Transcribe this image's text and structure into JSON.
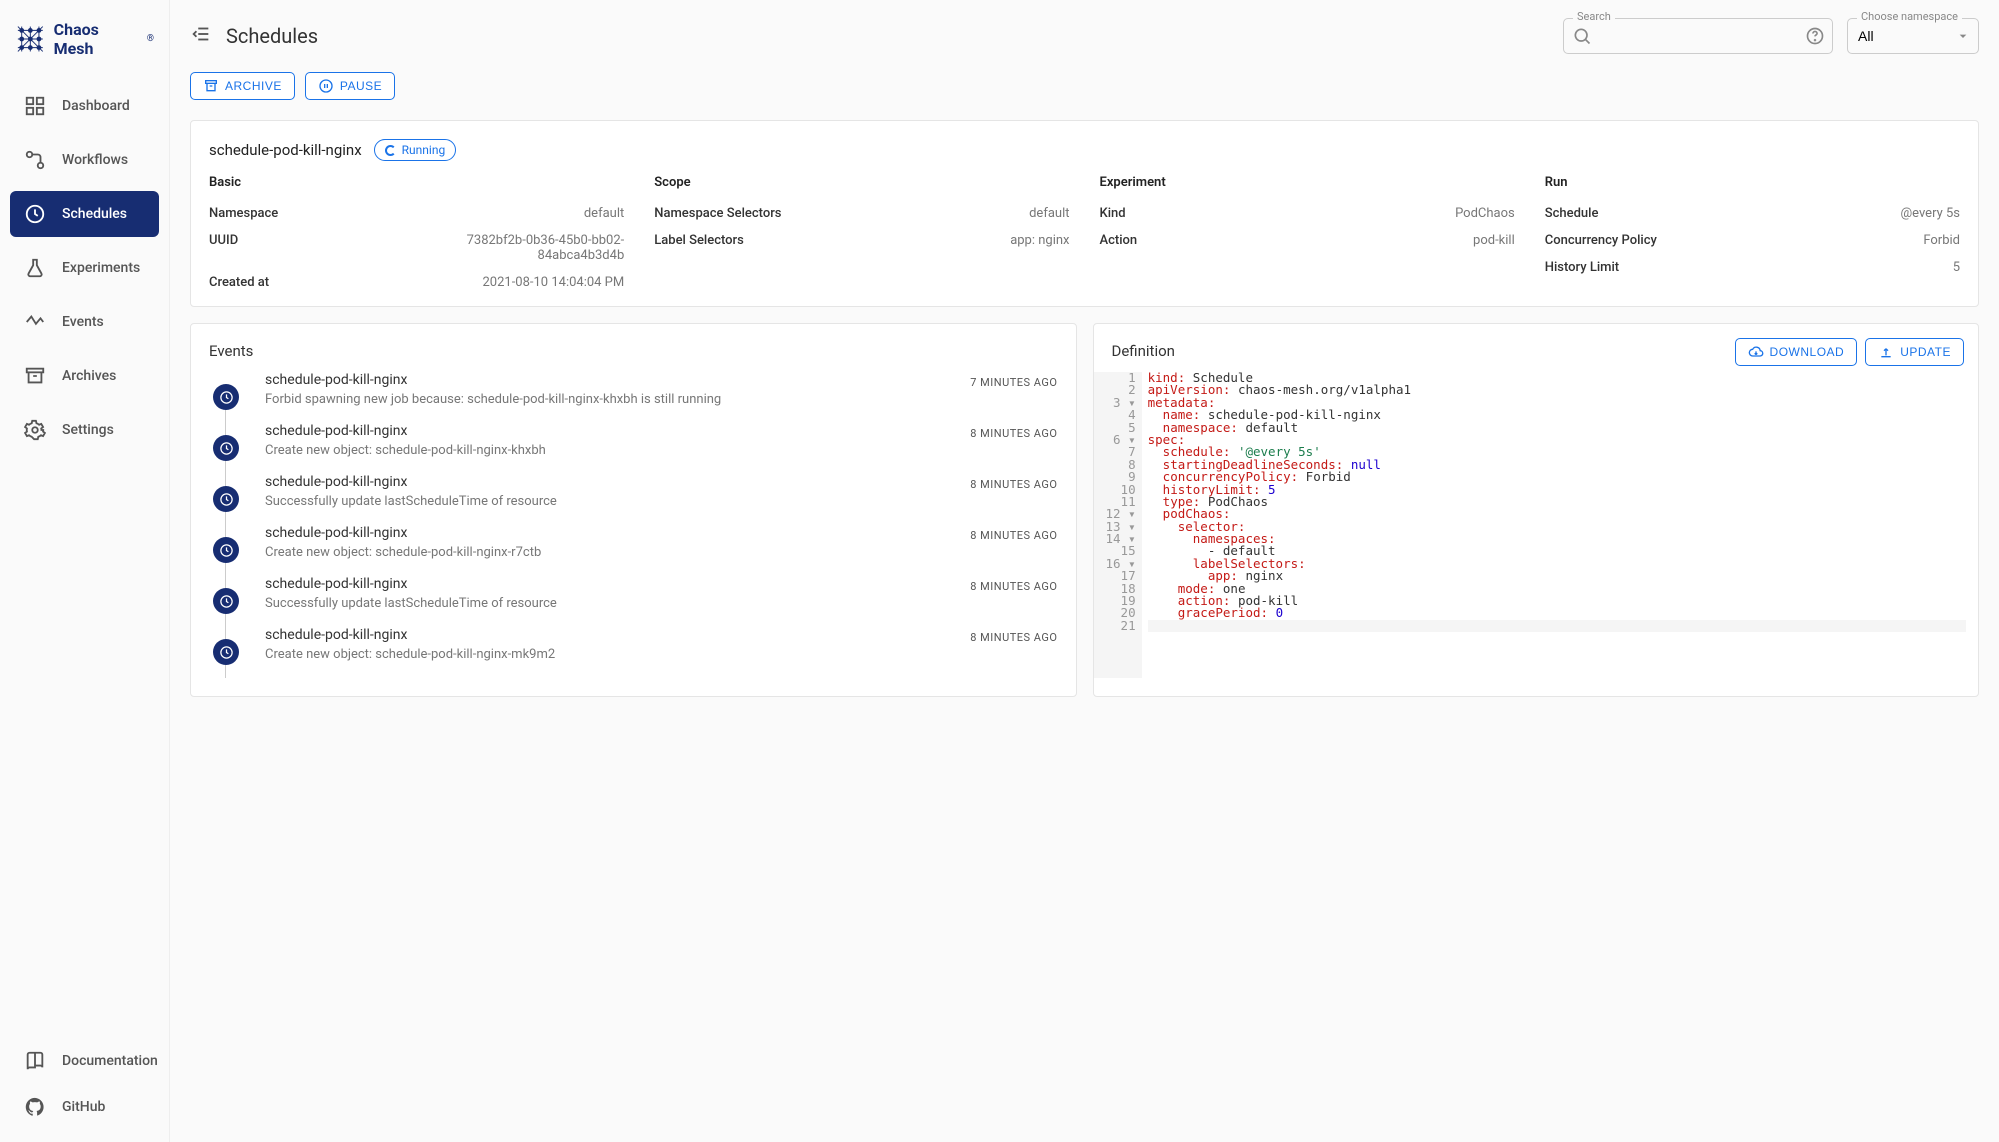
{
  "brand": "Chaos Mesh",
  "page_title": "Schedules",
  "search": {
    "label": "Search",
    "value": ""
  },
  "namespace": {
    "label": "Choose namespace",
    "value": "All"
  },
  "sidebar": {
    "items": [
      {
        "label": "Dashboard"
      },
      {
        "label": "Workflows"
      },
      {
        "label": "Schedules"
      },
      {
        "label": "Experiments"
      },
      {
        "label": "Events"
      },
      {
        "label": "Archives"
      },
      {
        "label": "Settings"
      }
    ],
    "bottom": [
      {
        "label": "Documentation"
      },
      {
        "label": "GitHub"
      }
    ]
  },
  "actions": {
    "archive": "ARCHIVE",
    "pause": "PAUSE"
  },
  "detail": {
    "name": "schedule-pod-kill-nginx",
    "status": "Running",
    "sections": {
      "basic": {
        "title": "Basic",
        "namespace_k": "Namespace",
        "namespace_v": "default",
        "uuid_k": "UUID",
        "uuid_v": "7382bf2b-0b36-45b0-bb02-84abca4b3d4b",
        "created_k": "Created at",
        "created_v": "2021-08-10 14:04:04 PM"
      },
      "scope": {
        "title": "Scope",
        "nssel_k": "Namespace Selectors",
        "nssel_v": "default",
        "labelsel_k": "Label Selectors",
        "labelsel_v": "app: nginx"
      },
      "experiment": {
        "title": "Experiment",
        "kind_k": "Kind",
        "kind_v": "PodChaos",
        "action_k": "Action",
        "action_v": "pod-kill"
      },
      "run": {
        "title": "Run",
        "schedule_k": "Schedule",
        "schedule_v": "@every 5s",
        "policy_k": "Concurrency Policy",
        "policy_v": "Forbid",
        "history_k": "History Limit",
        "history_v": "5"
      }
    }
  },
  "events_panel": {
    "title": "Events"
  },
  "events": [
    {
      "title": "schedule-pod-kill-nginx",
      "desc": "Forbid spawning new job because: schedule-pod-kill-nginx-khxbh is still running",
      "time": "7 MINUTES AGO"
    },
    {
      "title": "schedule-pod-kill-nginx",
      "desc": "Create new object: schedule-pod-kill-nginx-khxbh",
      "time": "8 MINUTES AGO"
    },
    {
      "title": "schedule-pod-kill-nginx",
      "desc": "Successfully update lastScheduleTime of resource",
      "time": "8 MINUTES AGO"
    },
    {
      "title": "schedule-pod-kill-nginx",
      "desc": "Create new object: schedule-pod-kill-nginx-r7ctb",
      "time": "8 MINUTES AGO"
    },
    {
      "title": "schedule-pod-kill-nginx",
      "desc": "Successfully update lastScheduleTime of resource",
      "time": "8 MINUTES AGO"
    },
    {
      "title": "schedule-pod-kill-nginx",
      "desc": "Create new object: schedule-pod-kill-nginx-mk9m2",
      "time": "8 MINUTES AGO"
    }
  ],
  "definition_panel": {
    "title": "Definition",
    "download": "DOWNLOAD",
    "update": "UPDATE"
  },
  "definition": {
    "lines": [
      {
        "n": "1",
        "fold": " ",
        "html": "<span class='tok-key'>kind:</span> <span class='tok-plain'>Schedule</span>"
      },
      {
        "n": "2",
        "fold": " ",
        "html": "<span class='tok-key'>apiVersion:</span> <span class='tok-plain'>chaos-mesh.org/v1alpha1</span>"
      },
      {
        "n": "3",
        "fold": "▾",
        "html": "<span class='tok-key'>metadata:</span>"
      },
      {
        "n": "4",
        "fold": " ",
        "html": "  <span class='tok-key'>name:</span> <span class='tok-plain'>schedule-pod-kill-nginx</span>"
      },
      {
        "n": "5",
        "fold": " ",
        "html": "  <span class='tok-key'>namespace:</span> <span class='tok-plain'>default</span>"
      },
      {
        "n": "6",
        "fold": "▾",
        "html": "<span class='tok-key'>spec:</span>"
      },
      {
        "n": "7",
        "fold": " ",
        "html": "  <span class='tok-key'>schedule:</span> <span class='tok-str'>'@every 5s'</span>"
      },
      {
        "n": "8",
        "fold": " ",
        "html": "  <span class='tok-key'>startingDeadlineSeconds:</span> <span class='tok-num'>null</span>"
      },
      {
        "n": "9",
        "fold": " ",
        "html": "  <span class='tok-key'>concurrencyPolicy:</span> <span class='tok-plain'>Forbid</span>"
      },
      {
        "n": "10",
        "fold": " ",
        "html": "  <span class='tok-key'>historyLimit:</span> <span class='tok-num'>5</span>"
      },
      {
        "n": "11",
        "fold": " ",
        "html": "  <span class='tok-key'>type:</span> <span class='tok-plain'>PodChaos</span>"
      },
      {
        "n": "12",
        "fold": "▾",
        "html": "  <span class='tok-key'>podChaos:</span>"
      },
      {
        "n": "13",
        "fold": "▾",
        "html": "    <span class='tok-key'>selector:</span>"
      },
      {
        "n": "14",
        "fold": "▾",
        "html": "      <span class='tok-key'>namespaces:</span>"
      },
      {
        "n": "15",
        "fold": " ",
        "html": "        <span class='tok-plain'>- default</span>"
      },
      {
        "n": "16",
        "fold": "▾",
        "html": "      <span class='tok-key'>labelSelectors:</span>"
      },
      {
        "n": "17",
        "fold": " ",
        "html": "        <span class='tok-key'>app:</span> <span class='tok-plain'>nginx</span>"
      },
      {
        "n": "18",
        "fold": " ",
        "html": "    <span class='tok-key'>mode:</span> <span class='tok-plain'>one</span>"
      },
      {
        "n": "19",
        "fold": " ",
        "html": "    <span class='tok-key'>action:</span> <span class='tok-plain'>pod-kill</span>"
      },
      {
        "n": "20",
        "fold": " ",
        "html": "    <span class='tok-key'>gracePeriod:</span> <span class='tok-num'>0</span>"
      },
      {
        "n": "21",
        "fold": " ",
        "html": "",
        "blank": true
      }
    ]
  }
}
